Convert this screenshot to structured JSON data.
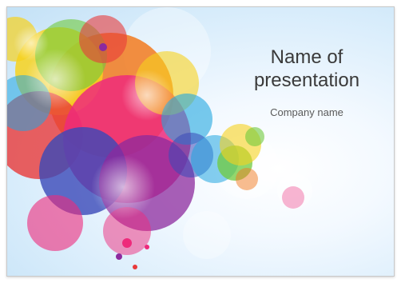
{
  "slide": {
    "title": "Name of presentation",
    "subtitle": "Company name"
  },
  "theme": {
    "background": "#d7ecfb",
    "text_color": "#3a3a3a",
    "splash_colors": [
      "#f7d21e",
      "#f27a1f",
      "#ee2a7b",
      "#8c2a9e",
      "#3a49b8",
      "#21a6e0",
      "#6fca3c",
      "#e83a3a"
    ]
  }
}
